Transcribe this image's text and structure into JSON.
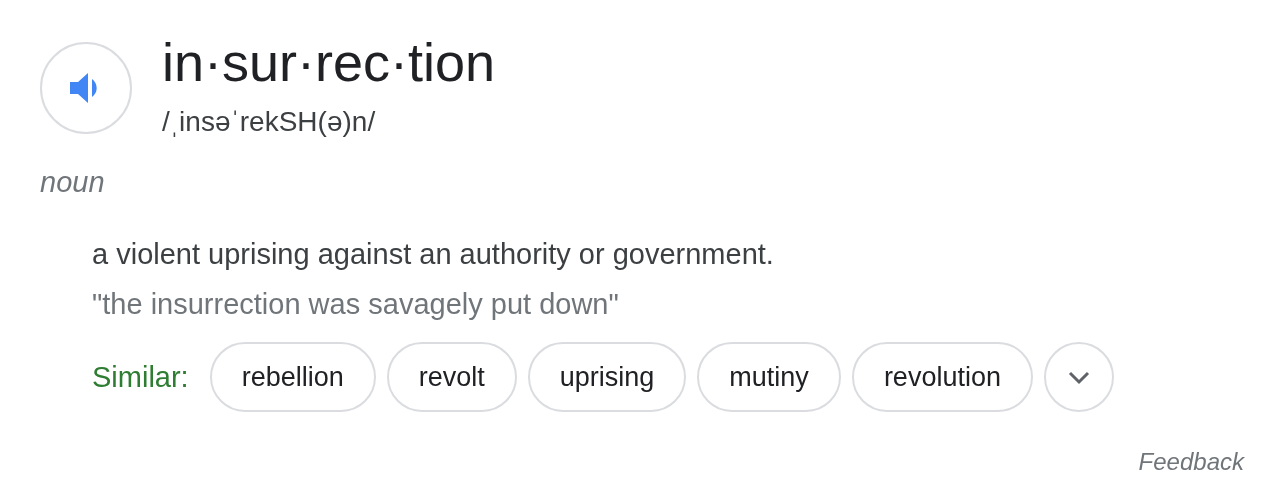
{
  "headword": "in·sur·rec·tion",
  "pronunciation": "/ˌinsəˈrekSH(ə)n/",
  "part_of_speech": "noun",
  "definition": "a violent uprising against an authority or government.",
  "example": "\"the insurrection was savagely put down\"",
  "similar": {
    "label": "Similar:",
    "words": [
      "rebellion",
      "revolt",
      "uprising",
      "mutiny",
      "revolution"
    ]
  },
  "feedback": "Feedback"
}
